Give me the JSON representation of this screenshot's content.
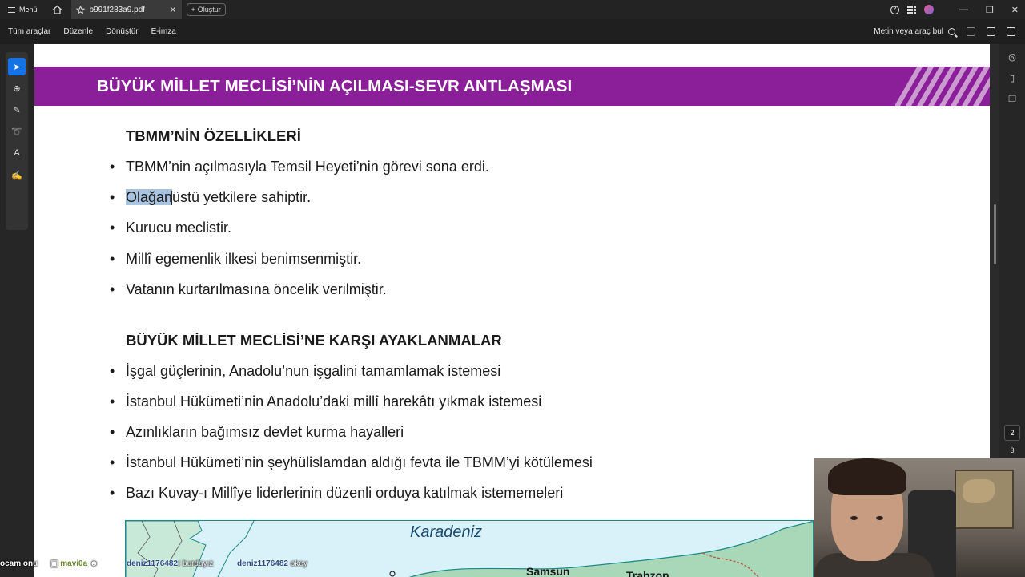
{
  "window": {
    "menu_label": "Menü",
    "tab_title": "b991f283a9.pdf",
    "new_tab_label": "Oluştur",
    "help_icon": "question-icon",
    "apps_icon": "grid-icon"
  },
  "menubar": {
    "items": [
      "Tüm araçlar",
      "Düzenle",
      "Dönüştür",
      "E-imza"
    ],
    "find_label": "Metin veya araç bul"
  },
  "document": {
    "banner_title": "BÜYÜK MİLLET MECLİSİ’NİN AÇILMASI-SEVR ANTLAŞMASI",
    "section1_heading": "TBMM’NİN ÖZELLİKLERİ",
    "section1_bullets": [
      "TBMM’nin açılmasıyla Temsil Heyeti’nin görevi sona erdi.",
      "Olağanüstü yetkilere sahiptir.",
      "Kurucu meclistir.",
      "Millî egemenlik ilkesi benimsenmiştir.",
      "Vatanın kurtarılmasına öncelik verilmiştir."
    ],
    "highlight_selected": "Olağan",
    "highlight_rest": "üstü yetkilere sahiptir.",
    "section2_heading": "BÜYÜK MİLLET MECLİSİ’NE KARŞI AYAKLANMALAR",
    "section2_bullets": [
      "İşgal güçlerinin, Anadolu’nun işgalini tamamlamak istemesi",
      "İstanbul Hükümeti’nin Anadolu’daki millî harekâtı yıkmak istemesi",
      "Azınlıkların bağımsız devlet kurma hayalleri",
      "İstanbul Hükümeti’nin şeyhülislamdan aldığı fevta ile TBMM’yi kötülemesi",
      "Bazı Kuvay-ı Millîye liderlerinin düzenli orduya katılmak istememeleri"
    ],
    "map_labels": [
      "Karadeniz",
      "Samsun",
      "Trabzon"
    ]
  },
  "pages": {
    "current": "2",
    "next": "3"
  },
  "chat": {
    "left_fragment": "ocam onu",
    "user1": "mavi0a",
    "user2": "deniz1176482",
    "msg2": "burdayız",
    "user3": "deniz1176482",
    "msg3": "okey"
  },
  "colors": {
    "banner": "#8b1f9a",
    "accent_blue": "#1473e6",
    "selection": "#a8c4e0"
  }
}
